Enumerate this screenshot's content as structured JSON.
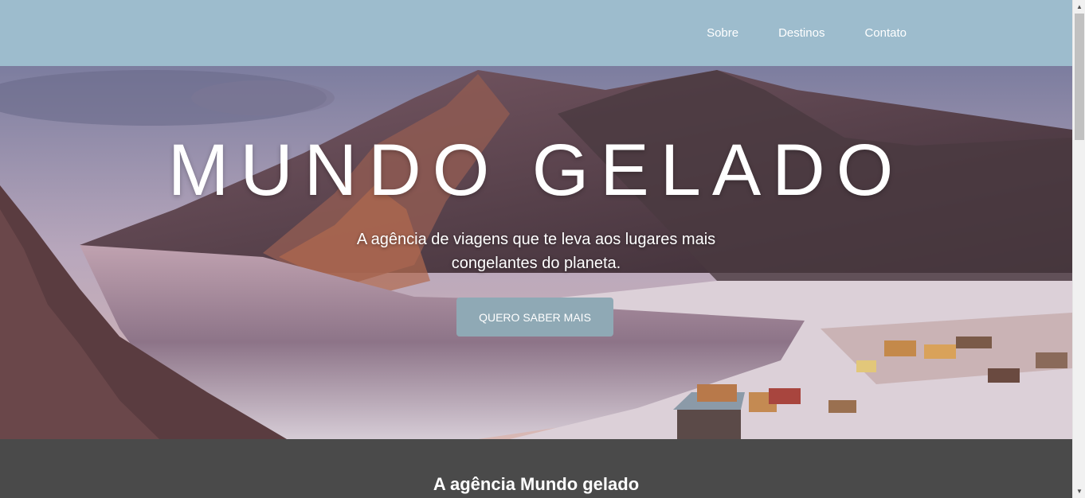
{
  "nav": {
    "items": [
      {
        "label": "Sobre"
      },
      {
        "label": "Destinos"
      },
      {
        "label": "Contato"
      }
    ]
  },
  "hero": {
    "title": "MUNDO GELADO",
    "subtitle": "A agência de viagens que te leva aos lugares mais congelantes do planeta.",
    "button_label": "QUERO SABER MAIS",
    "image": "frozen lake with snowy mountains and village at sunset"
  },
  "about": {
    "title": "A agência Mundo gelado"
  },
  "colors": {
    "header_bg": "#9dbccd",
    "button_bg": "#8fa9b5",
    "section_bg": "#4a4a4a",
    "text": "#ffffff"
  },
  "icons": {
    "scroll_up": "triangle-up-icon",
    "scroll_down": "triangle-down-icon"
  }
}
